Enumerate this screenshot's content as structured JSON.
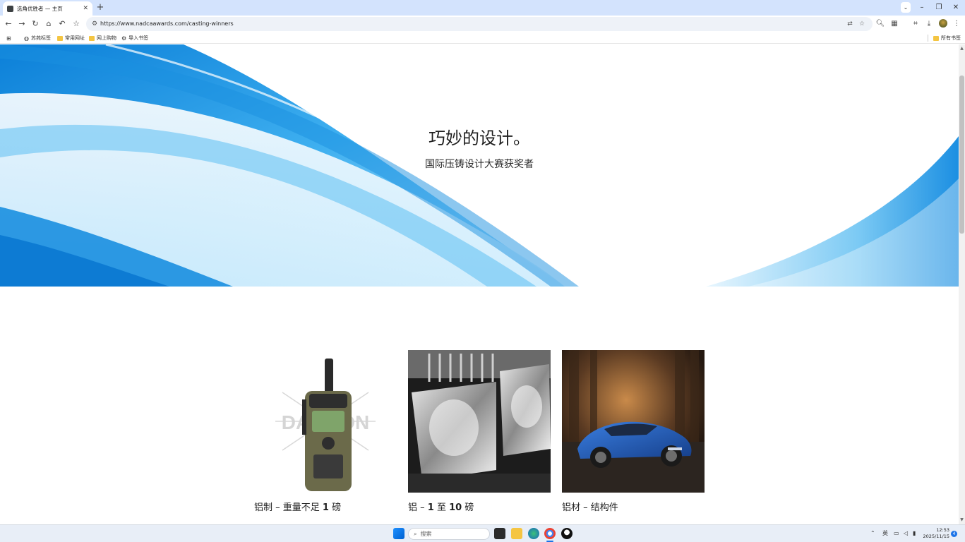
{
  "browser": {
    "tab_title": "选角优胜者 — 主页",
    "url": "https://www.nadcaawards.com/casting-winners",
    "bookmarks": [
      {
        "label": "苏苑标签"
      },
      {
        "label": "常用网址"
      },
      {
        "label": "网上购物"
      },
      {
        "label": "导入书签"
      }
    ],
    "all_bookmarks_label": "所有书签"
  },
  "hero": {
    "title": "巧妙的设计。",
    "subtitle": "国际压铸设计大赛获奖者"
  },
  "cards": [
    {
      "caption_pre": "铝制 – 重量不足 ",
      "caption_bold": "1",
      "caption_post": " 磅",
      "image": "radio-device",
      "watermark": "DANGON"
    },
    {
      "caption_pre": "铝 – ",
      "caption_bold": "1",
      "caption_mid": " 至 ",
      "caption_bold2": "10",
      "caption_post": " 磅",
      "image": "headlamp"
    },
    {
      "caption_pre": "铝材 – 结构件",
      "image": "blue-car"
    }
  ],
  "taskbar": {
    "search_placeholder": "搜索",
    "ime": "英",
    "time": "12:53",
    "date": "2025/11/15",
    "notification_count": "4"
  },
  "colors": {
    "tab_strip": "#d3e3fd",
    "hero_blue": "#1a8fe0",
    "taskbar": "#e8eef7"
  }
}
